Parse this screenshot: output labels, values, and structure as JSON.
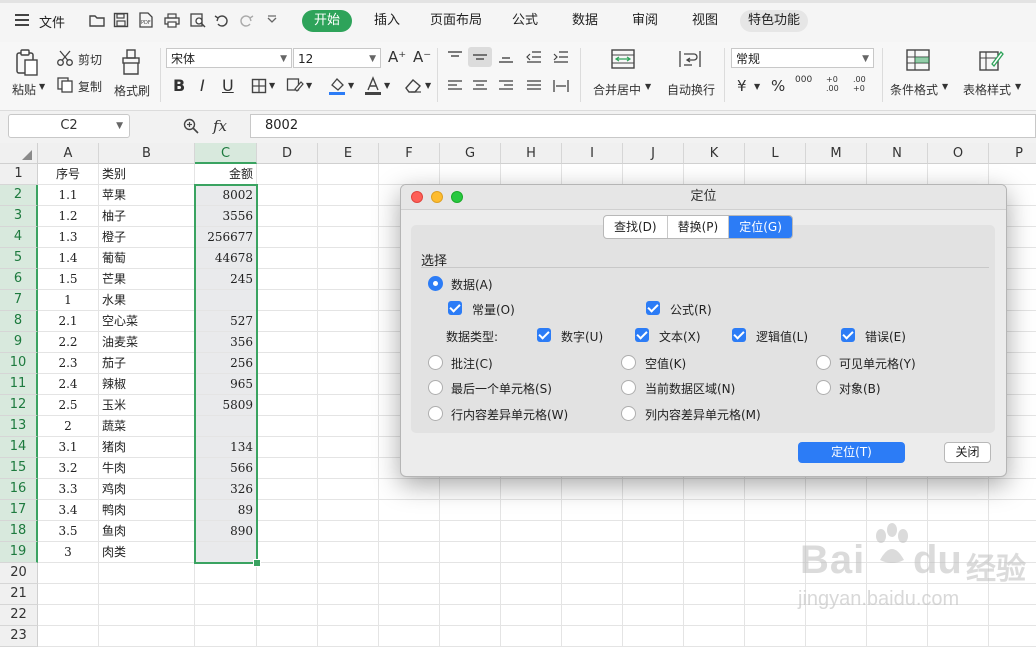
{
  "menubar": {
    "file_label": "文件",
    "tabs": [
      {
        "label": "开始"
      },
      {
        "label": "插入"
      },
      {
        "label": "页面布局"
      },
      {
        "label": "公式"
      },
      {
        "label": "数据"
      },
      {
        "label": "审阅"
      },
      {
        "label": "视图"
      },
      {
        "label": "特色功能"
      }
    ],
    "quick_icons": [
      "open-folder-icon",
      "save-icon",
      "pdf-export-icon",
      "print-icon",
      "print-preview-icon",
      "undo-icon",
      "redo-icon",
      "customize-dropdown-icon"
    ]
  },
  "ribbon": {
    "paste_label": "粘贴",
    "cut_label": "剪切",
    "copy_label": "复制",
    "format_painter_label": "格式刷",
    "font_name": "宋体",
    "font_size": "12",
    "bold": "B",
    "italic": "I",
    "underline": "U",
    "merge_label": "合并居中",
    "wrap_label": "自动换行",
    "number_format": "常规",
    "currency_symbol": "¥",
    "percent_symbol": "%",
    "thousands_symbol": "000",
    "increase_decimal": "+0 .00",
    "decrease_decimal": ".00 +0",
    "conditional_format_label": "条件格式",
    "table_style_label": "表格样式"
  },
  "formula_bar": {
    "name_box": "C2",
    "fx_label": "fx",
    "value": "8002"
  },
  "grid": {
    "columns": [
      "A",
      "B",
      "C",
      "D",
      "E",
      "F",
      "G",
      "H",
      "I",
      "J",
      "K",
      "L",
      "M",
      "N",
      "O",
      "P"
    ],
    "selected_column": "C",
    "row_numbers": [
      "1",
      "2",
      "3",
      "4",
      "5",
      "6",
      "7",
      "8",
      "9",
      "10",
      "11",
      "12",
      "13",
      "14",
      "15",
      "16",
      "17",
      "18",
      "19",
      "20",
      "21",
      "22",
      "23"
    ],
    "rows": [
      {
        "a": "序号",
        "b": "类别",
        "c": "金额"
      },
      {
        "a": "1.1",
        "b": "苹果",
        "c": "8002"
      },
      {
        "a": "1.2",
        "b": "柚子",
        "c": "3556"
      },
      {
        "a": "1.3",
        "b": "橙子",
        "c": "256677"
      },
      {
        "a": "1.4",
        "b": "葡萄",
        "c": "44678"
      },
      {
        "a": "1.5",
        "b": "芒果",
        "c": "245"
      },
      {
        "a": "1",
        "b": "水果",
        "c": ""
      },
      {
        "a": "2.1",
        "b": "空心菜",
        "c": "527"
      },
      {
        "a": "2.2",
        "b": "油麦菜",
        "c": "356"
      },
      {
        "a": "2.3",
        "b": "茄子",
        "c": "256"
      },
      {
        "a": "2.4",
        "b": "辣椒",
        "c": "965"
      },
      {
        "a": "2.5",
        "b": "玉米",
        "c": "5809"
      },
      {
        "a": "2",
        "b": "蔬菜",
        "c": ""
      },
      {
        "a": "3.1",
        "b": "猪肉",
        "c": "134"
      },
      {
        "a": "3.2",
        "b": "牛肉",
        "c": "566"
      },
      {
        "a": "3.3",
        "b": "鸡肉",
        "c": "326"
      },
      {
        "a": "3.4",
        "b": "鸭肉",
        "c": "89"
      },
      {
        "a": "3.5",
        "b": "鱼肉",
        "c": "890"
      },
      {
        "a": "3",
        "b": "肉类",
        "c": ""
      }
    ]
  },
  "dialog": {
    "title": "定位",
    "tabs": [
      {
        "label": "查找(D)"
      },
      {
        "label": "替换(P)"
      },
      {
        "label": "定位(G)"
      }
    ],
    "section_label": "选择",
    "data_option": "数据(A)",
    "constants": "常量(O)",
    "formulas": "公式(R)",
    "data_types_label": "数据类型:",
    "types": [
      {
        "label": "数字(U)"
      },
      {
        "label": "文本(X)"
      },
      {
        "label": "逻辑值(L)"
      },
      {
        "label": "错误(E)"
      }
    ],
    "options": [
      {
        "label": "批注(C)"
      },
      {
        "label": "空值(K)"
      },
      {
        "label": "可见单元格(Y)"
      },
      {
        "label": "最后一个单元格(S)"
      },
      {
        "label": "当前数据区域(N)"
      },
      {
        "label": "对象(B)"
      },
      {
        "label": "行内容差异单元格(W)"
      },
      {
        "label": "列内容差异单元格(M)"
      }
    ],
    "locate_button": "定位(T)",
    "close_button": "关闭"
  },
  "watermark": {
    "logo": "Bai",
    "logo_suffix": "du",
    "label": "经验",
    "url": "jingyan.baidu.com"
  },
  "colors": {
    "accent_green": "#2ea35a",
    "selection_green": "#3aa361",
    "dialog_blue": "#2c7cf6"
  }
}
